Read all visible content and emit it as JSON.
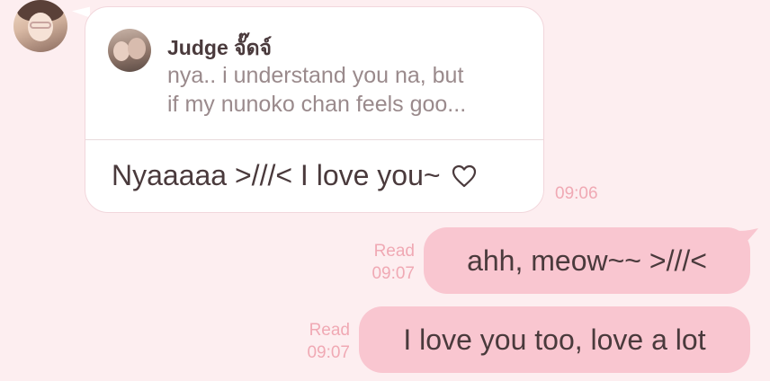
{
  "incoming": {
    "reply_preview": {
      "name": "Judge จั๊ดจ์",
      "line1": "nya.. i understand you na, but",
      "line2": "if my nunoko chan feels goo..."
    },
    "text": "Nyaaaaa >///< I love you~",
    "icon": "heart-icon",
    "time": "09:06"
  },
  "outgoing": [
    {
      "text": "ahh, meow~~ >///<",
      "read_label": "Read",
      "time": "09:07"
    },
    {
      "text": "I love you too, love a lot",
      "read_label": "Read",
      "time": "09:07"
    }
  ],
  "colors": {
    "background": "#fdeef0",
    "incoming_bubble": "#ffffff",
    "outgoing_bubble": "#f9c6d0",
    "meta_text": "#f0a9b4"
  }
}
